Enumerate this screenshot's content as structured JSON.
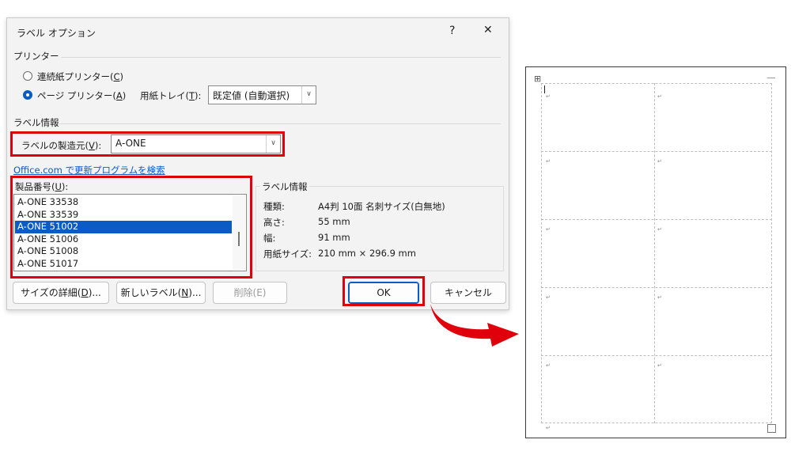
{
  "dialog": {
    "title": "ラベル オプション",
    "help": "?",
    "close": "✕",
    "printer_group": "プリンター",
    "continuous_prefix": "連続紙プリンター(",
    "continuous_key": "C",
    "page_prefix": "ページ プリンター(",
    "page_key": "A",
    "suffix": ")",
    "tray_prefix": "用紙トレイ(",
    "tray_key": "T",
    "tray_suffix": "):",
    "tray_value": "既定値 (自動選択)",
    "label_info_group": "ラベル情報",
    "vendor_prefix": "ラベルの製造元(",
    "vendor_key": "V",
    "vendor_suffix": "):",
    "vendor_value": "A-ONE",
    "update_link": "Office.com で更新プログラムを検索",
    "product_prefix": "製品番号(",
    "product_key": "U",
    "product_suffix": "):",
    "products": [
      "A-ONE 33538",
      "A-ONE 33539",
      "A-ONE 51002",
      "A-ONE 51006",
      "A-ONE 51008",
      "A-ONE 51017"
    ],
    "details_group": "ラベル情報",
    "type_label": "種類:",
    "type_value": "A4判 10面 名刺サイズ(白無地)",
    "height_label": "高さ:",
    "height_value": "55 mm",
    "width_label": "幅:",
    "width_value": "91 mm",
    "paper_label": "用紙サイズ:",
    "paper_value": "210 mm × 296.9 mm",
    "details_btn_prefix": "サイズの詳細(",
    "details_btn_key": "D",
    "details_btn_suffix": ")...",
    "new_btn_prefix": "新しいラベル(",
    "new_btn_key": "N",
    "new_btn_suffix": ")...",
    "delete_btn": "削除(E)",
    "ok_btn": "OK",
    "cancel_btn": "キャンセル"
  },
  "preview": {
    "move_handle": "⊞",
    "paragraph_mark": "↵"
  },
  "colors": {
    "accent": "#0a5bc4",
    "highlight": "#e0000b"
  }
}
